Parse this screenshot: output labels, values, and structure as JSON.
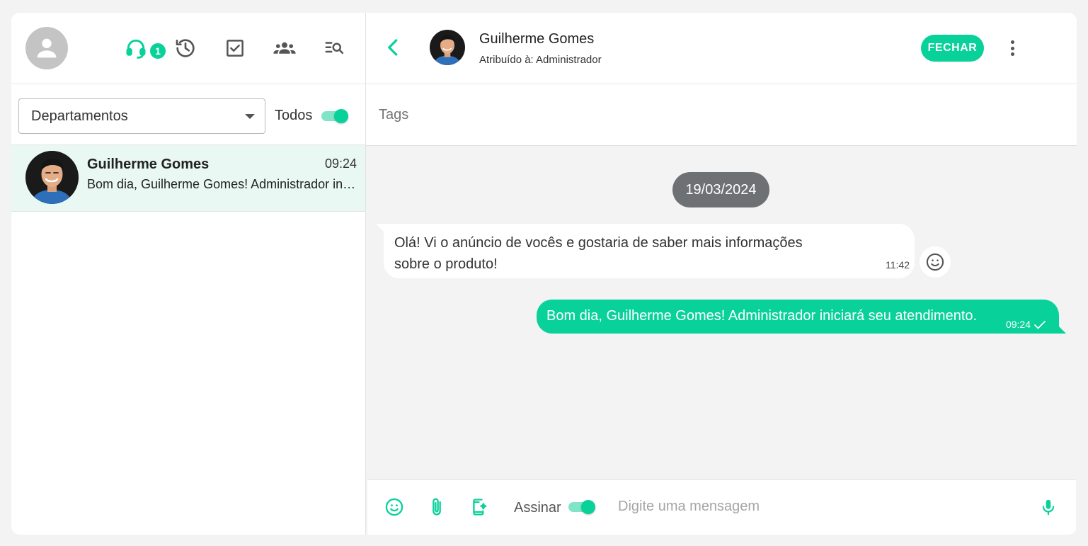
{
  "sidebar": {
    "badge_count": "1",
    "nav_icons": [
      "headset-icon",
      "history-icon",
      "checkbox-icon",
      "groups-icon",
      "search-list-icon"
    ],
    "department_select": {
      "value": "Departamentos"
    },
    "todos": {
      "label": "Todos",
      "checked": true
    },
    "chats": [
      {
        "name": "Guilherme Gomes",
        "time": "09:24",
        "preview": "Bom dia, Guilherme Gomes! Administrador iniciará seu atendimento."
      }
    ]
  },
  "header": {
    "contact_name": "Guilherme Gomes",
    "assigned": "Atribuído à: Administrador",
    "close_button": "FECHAR"
  },
  "tags": {
    "placeholder": "Tags"
  },
  "conversation": {
    "date": "19/03/2024",
    "messages": [
      {
        "direction": "incoming",
        "text": "Olá! Vi o anúncio de vocês e gostaria de saber mais informações sobre o produto!",
        "time": "11:42"
      },
      {
        "direction": "outgoing",
        "text": "Bom dia, Guilherme Gomes! Administrador iniciará seu atendimento.",
        "time": "09:24",
        "status": "sent"
      }
    ]
  },
  "composer": {
    "sign_label": "Assinar",
    "sign_checked": true,
    "placeholder": "Digite uma mensagem"
  },
  "colors": {
    "accent": "#08d19a",
    "accent_light": "#7fe5c6",
    "selected_chat_bg": "#e9f8f2",
    "date_pill_bg": "#6e7174",
    "chat_bg": "#f3f3f3"
  }
}
